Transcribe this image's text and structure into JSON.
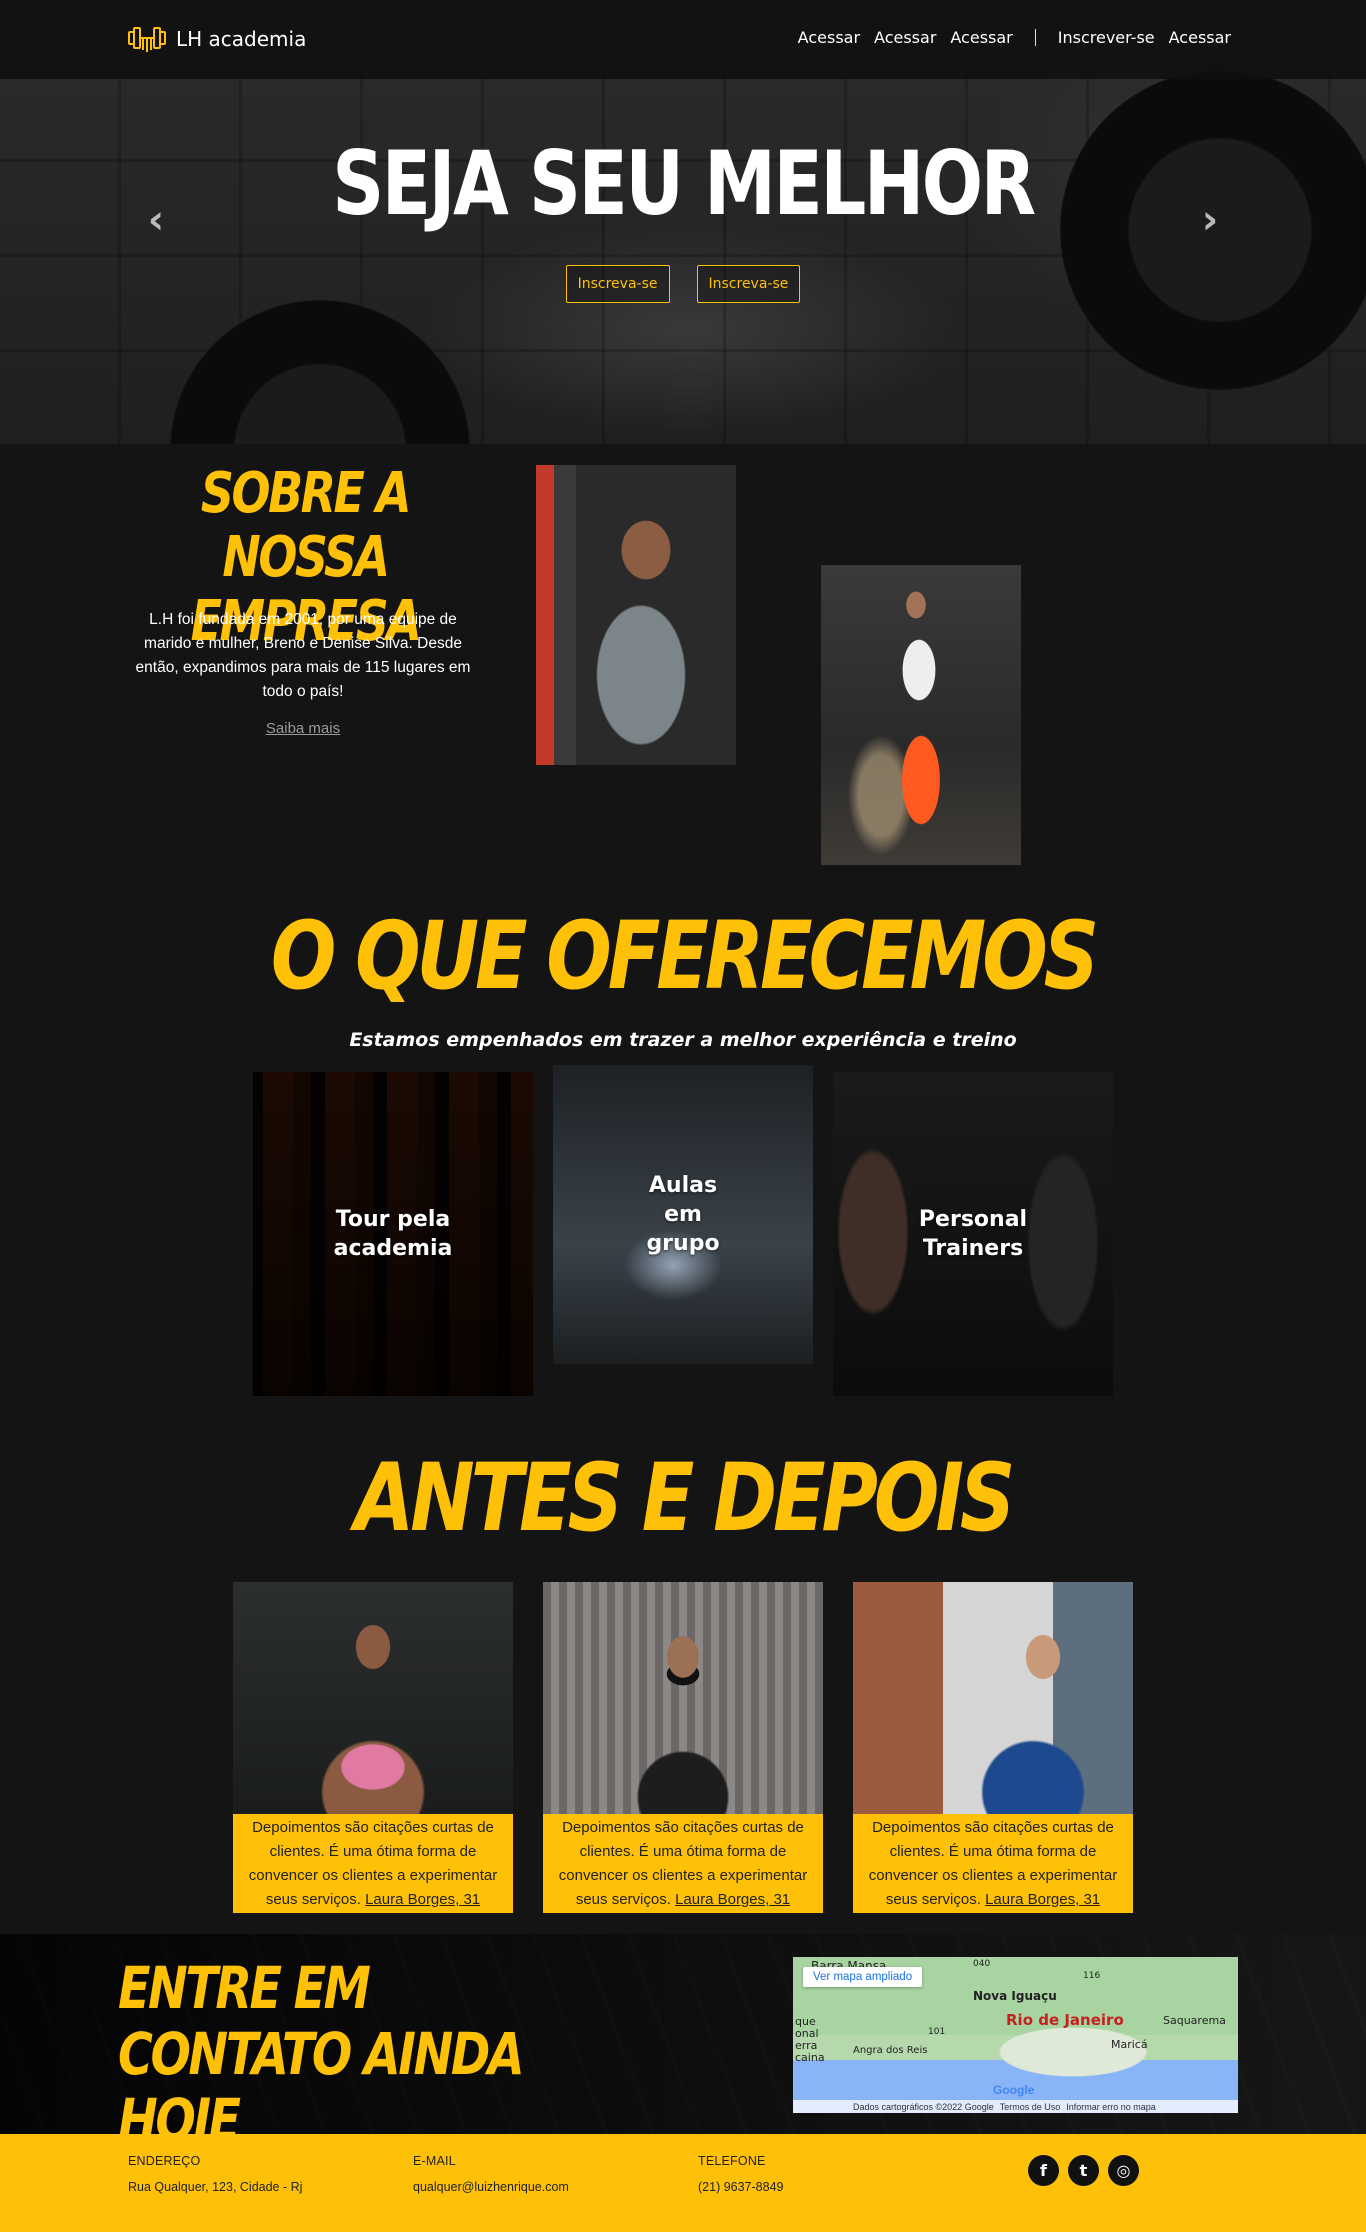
{
  "brand": {
    "name": "LH academia",
    "logo_icon": "dumbbell-icon"
  },
  "nav": {
    "links": [
      "Acessar",
      "Acessar",
      "Acessar"
    ],
    "right_links": [
      "Inscrever-se",
      "Acessar"
    ]
  },
  "hero": {
    "title": "SEJA SEU MELHOR",
    "buttons": [
      "Inscreva-se",
      "Inscreva-se"
    ],
    "prev_arrow": "‹",
    "next_arrow": "›"
  },
  "about": {
    "title": "SOBRE A NOSSA EMPRESA",
    "text": "L.H foi fundada em 2001, por uma equipe de marido e mulher, Breno e Denise Silva. Desde então, expandimos para mais de 115 lugares em todo o país!",
    "link": "Saiba mais"
  },
  "offer": {
    "title": "O QUE OFERECEMOS",
    "subtitle": "Estamos empenhados em trazer a melhor experiência e treino",
    "cards": [
      "Tour pela academia",
      "Aulas em grupo",
      "Personal Trainers"
    ]
  },
  "before_after": {
    "title": "ANTES E DEPOIS",
    "testimonials": [
      {
        "text": "Depoimentos são citações curtas de clientes. É uma ótima forma de convencer os clientes a experimentar seus serviços.",
        "name": "Laura Borges, 31"
      },
      {
        "text": "Depoimentos são citações curtas de clientes. É uma ótima forma de convencer os clientes a experimentar seus serviços.",
        "name": "Laura Borges, 31"
      },
      {
        "text": "Depoimentos são citações curtas de clientes. É uma ótima forma de convencer os clientes a experimentar seus serviços.",
        "name": "Laura Borges, 31"
      }
    ]
  },
  "contact": {
    "title": "ENTRE EM CONTATO AINDA HOJE",
    "map": {
      "button": "Ver mapa ampliado",
      "labels": [
        "Barra Mansa",
        "Nova Iguaçu",
        "Saquarema",
        "Maricá",
        "Angra dos Reis",
        "que",
        "onal",
        "erra",
        "caina",
        "040",
        "116",
        "101"
      ],
      "city": "Rio de Janeiro",
      "google": "Google",
      "footer": [
        "Dados cartográficos ©2022 Google",
        "Termos de Uso",
        "Informar erro no mapa"
      ]
    }
  },
  "footer": {
    "address_label": "ENDEREÇO",
    "address": "Rua Qualquer, 123, Cidade - Rj",
    "email_label": "E-MAIL",
    "email": "qualquer@luizhenrique.com",
    "phone_label": "TELEFONE",
    "phone": "(21) 9637-8849",
    "social": [
      "f",
      "t",
      "◎"
    ],
    "social_icons": [
      "facebook-icon",
      "twitter-icon",
      "instagram-icon"
    ]
  },
  "colors": {
    "accent": "#ffc107",
    "background": "#141414"
  }
}
